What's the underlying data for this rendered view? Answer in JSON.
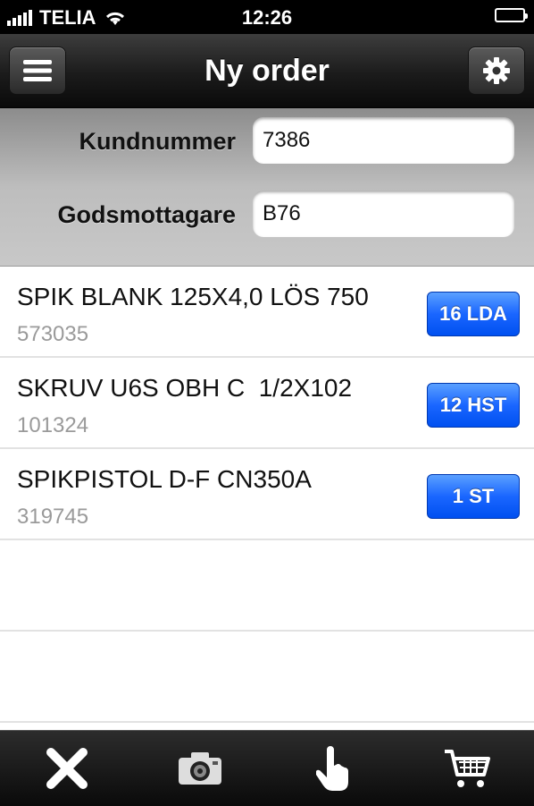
{
  "status_bar": {
    "carrier": "TELIA",
    "time": "12:26"
  },
  "nav": {
    "title": "Ny order",
    "menu_icon": "menu-icon",
    "settings_icon": "gear-icon"
  },
  "form": {
    "kundnummer_label": "Kundnummer",
    "kundnummer_value": "7386",
    "godsmottagare_label": "Godsmottagare",
    "godsmottagare_value": "B76"
  },
  "items": [
    {
      "name": "SPIK BLANK 125X4,0 LÖS 750",
      "code": "573035",
      "qty": "16 LDA"
    },
    {
      "name": "SKRUV U6S OBH C  1/2X102",
      "code": "101324",
      "qty": "12 HST"
    },
    {
      "name": "SPIKPISTOL D-F CN350A",
      "code": "319745",
      "qty": "1 ST"
    }
  ],
  "toolbar": {
    "icons": [
      "close-icon",
      "camera-icon",
      "touch-icon",
      "cart-icon"
    ]
  },
  "colors": {
    "badge": "#1a66ff",
    "navbar": "#1b1b1b"
  }
}
